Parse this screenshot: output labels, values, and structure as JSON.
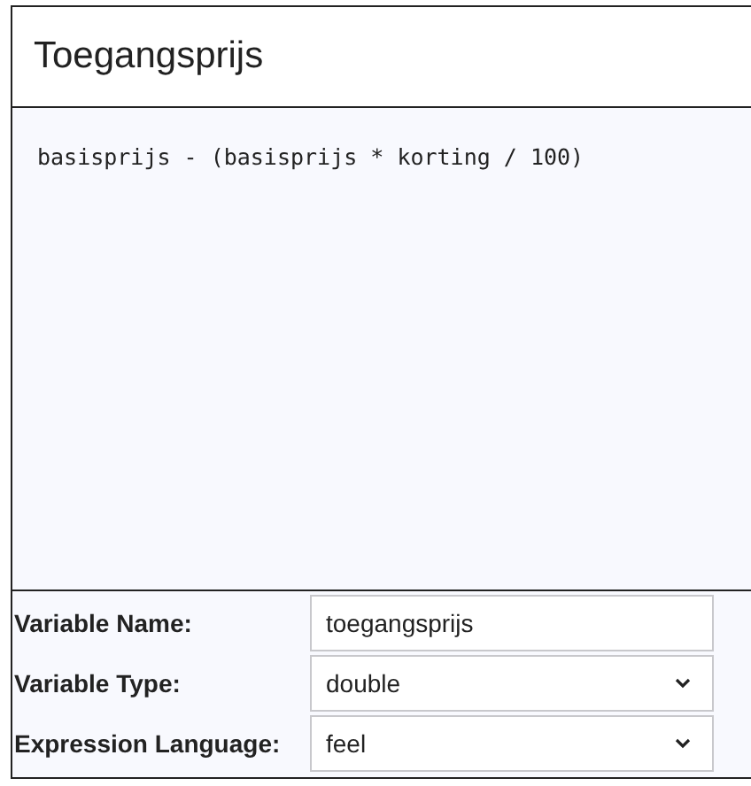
{
  "title": "Toegangsprijs",
  "expression": "basisprijs - (basisprijs * korting / 100)",
  "fields": [
    {
      "label": "Variable Name:",
      "kind": "text",
      "value": "toegangsprijs"
    },
    {
      "label": "Variable Type:",
      "kind": "select",
      "value": "double"
    },
    {
      "label": "Expression Language:",
      "kind": "select",
      "value": "feel"
    }
  ]
}
